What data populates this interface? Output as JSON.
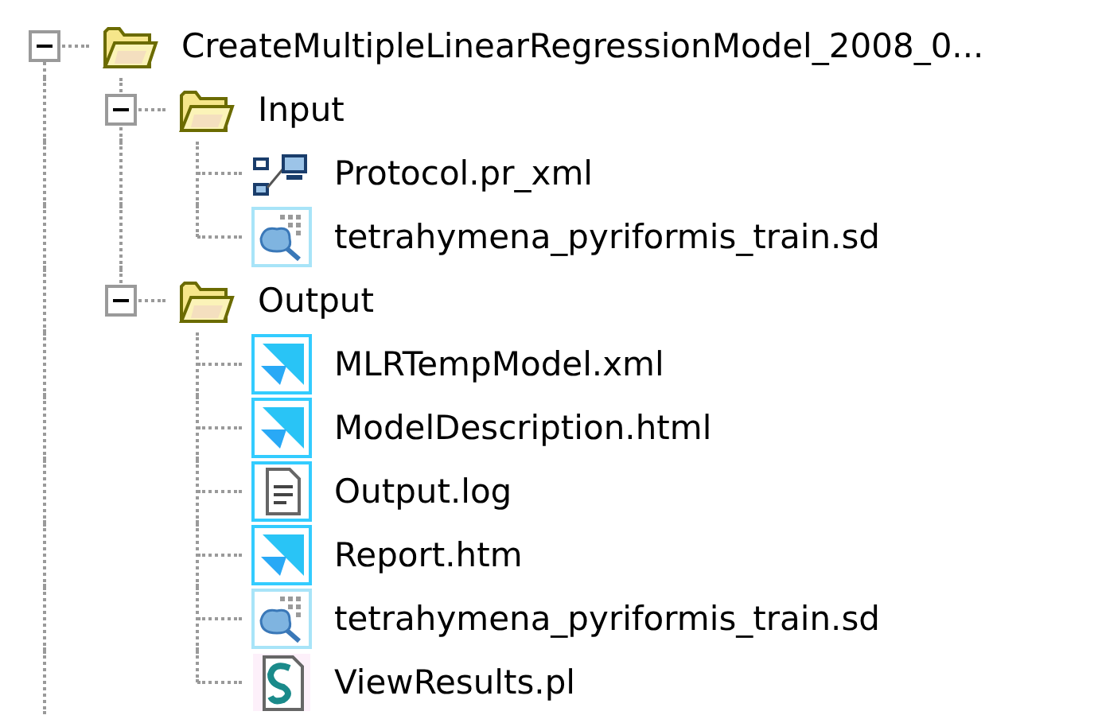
{
  "tree": [
    {
      "label": "CreateMultipleLinearRegressionModel_2008_0...",
      "kind": "folder",
      "expanded": true,
      "children": [
        {
          "label": "Input",
          "kind": "folder",
          "expanded": true,
          "children": [
            {
              "label": "Protocol.pr_xml",
              "kind": "protocol"
            },
            {
              "label": "tetrahymena_pyriformis_train.sd",
              "kind": "dataset"
            }
          ]
        },
        {
          "label": "Output",
          "kind": "folder",
          "expanded": true,
          "children": [
            {
              "label": "MLRTempModel.xml",
              "kind": "tile"
            },
            {
              "label": "ModelDescription.html",
              "kind": "tile"
            },
            {
              "label": "Output.log",
              "kind": "log"
            },
            {
              "label": "Report.htm",
              "kind": "tile"
            },
            {
              "label": "tetrahymena_pyriformis_train.sd",
              "kind": "dataset"
            },
            {
              "label": "ViewResults.pl",
              "kind": "script"
            }
          ]
        }
      ]
    }
  ]
}
